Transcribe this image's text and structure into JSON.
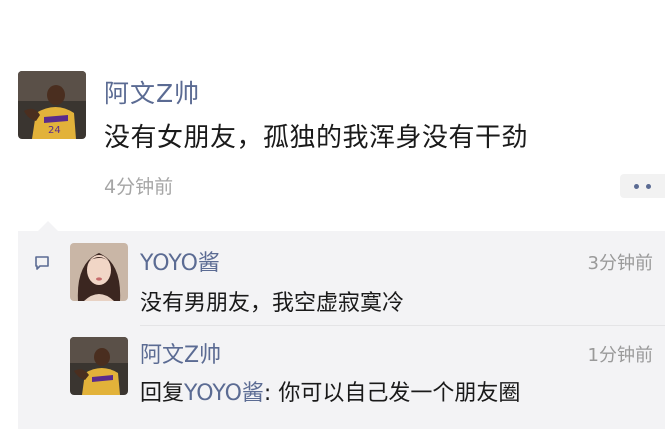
{
  "post": {
    "author": "阿文Z帅",
    "content": "没有女朋友，孤独的我浑身没有干劲",
    "time": "4分钟前"
  },
  "comments": [
    {
      "name": "YOYO酱",
      "time": "3分钟前",
      "text": "没有男朋友，我空虚寂寞冷"
    },
    {
      "name": "阿文Z帅",
      "time": "1分钟前",
      "reply_prefix": "回复",
      "reply_to": "YOYO酱",
      "text": ": 你可以自己发一个朋友圈"
    }
  ],
  "icons": {
    "more": "more-dots-icon",
    "comment": "comment-bubble-icon"
  },
  "colors": {
    "name_link": "#5b6b93",
    "comment_bg": "#f3f3f5",
    "time_gray": "#a6a6a6"
  }
}
